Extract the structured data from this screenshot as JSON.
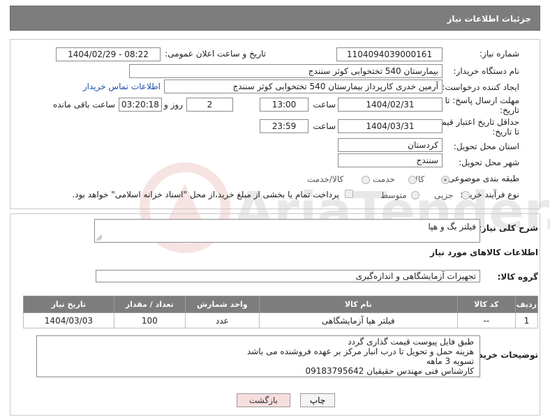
{
  "header": {
    "title": "جزئیات اطلاعات نیاز"
  },
  "labels": {
    "need_number": "شماره نیاز:",
    "announce_datetime": "تاریخ و ساعت اعلان عمومی:",
    "buyer_org": "نام دستگاه خریدار:",
    "requester": "ایجاد کننده درخواست:",
    "contact_link": "اطلاعات تماس خریدار",
    "reply_deadline_1": "مهلت ارسال پاسخ: تا",
    "reply_deadline_2": "تاریخ:",
    "hour": "ساعت",
    "days_and": "روز و",
    "hours_left": "ساعت باقی مانده",
    "price_validity_1": "حداقل تاریخ اعتبار قیمت:",
    "price_validity_2": "تا تاریخ:",
    "delivery_province": "استان محل تحویل:",
    "delivery_city": "شهر محل تحویل:",
    "subject_class": "طبقه بندی موضوعی:",
    "purchase_process": "نوع فرآیند خرید :",
    "general_desc": "شرح کلی نیاز:",
    "goods_info": "اطلاعات کالاهای مورد نیاز",
    "goods_group": "گروه کالا:",
    "buyer_notes": "توضیحات خریدار:"
  },
  "values": {
    "need_number": "1104094039000161",
    "announce_datetime": "1404/02/29 - 08:22",
    "buyer_org": "بیمارستان 540 تختخوابی کوثر سنندج",
    "requester": "آرمین خدری کارپرداز بیمارستان 540 تختخوابی کوثر سنندج",
    "reply_date": "1404/02/31",
    "reply_time": "13:00",
    "reply_days": "2",
    "reply_remaining": "03:20:18",
    "price_date": "1404/03/31",
    "price_time": "23:59",
    "province": "کردستان",
    "city": "سنندج",
    "general_desc": "فیلتر بگ و هپا",
    "goods_group": "تجهیزات آزمایشگاهی و اندازه‌گیری"
  },
  "subject_options": [
    {
      "label": "کالا",
      "selected": true
    },
    {
      "label": "خدمت",
      "selected": false
    },
    {
      "label": "کالا/خدمت",
      "selected": false
    }
  ],
  "process_options": [
    {
      "label": "جزیی",
      "selected": false
    },
    {
      "label": "متوسط",
      "selected": false
    }
  ],
  "payment_note": "پرداخت تمام یا بخشی از مبلغ خرید،از محل \"اسناد خزانه اسلامی\" خواهد بود.",
  "table": {
    "headers": [
      "ردیف",
      "کد کالا",
      "نام کالا",
      "واحد شمارش",
      "تعداد / مقدار",
      "تاریخ نیاز"
    ],
    "rows": [
      [
        "1",
        "--",
        "فیلتر هپا آزمایشگاهی",
        "عدد",
        "100",
        "1404/03/03"
      ]
    ]
  },
  "buyer_notes": "طبق فایل پیوست قیمت گذاری گردد\nهزینه حمل و تحویل تا درب انبار مرکز بر عهده فروشنده می باشد\nتسویه 3 ماهه\nکارشناس فنی مهندس حقیقیان 09183795642",
  "buttons": {
    "print": "چاپ",
    "back": "بازگشت"
  },
  "watermark": "AriaTender.neT"
}
